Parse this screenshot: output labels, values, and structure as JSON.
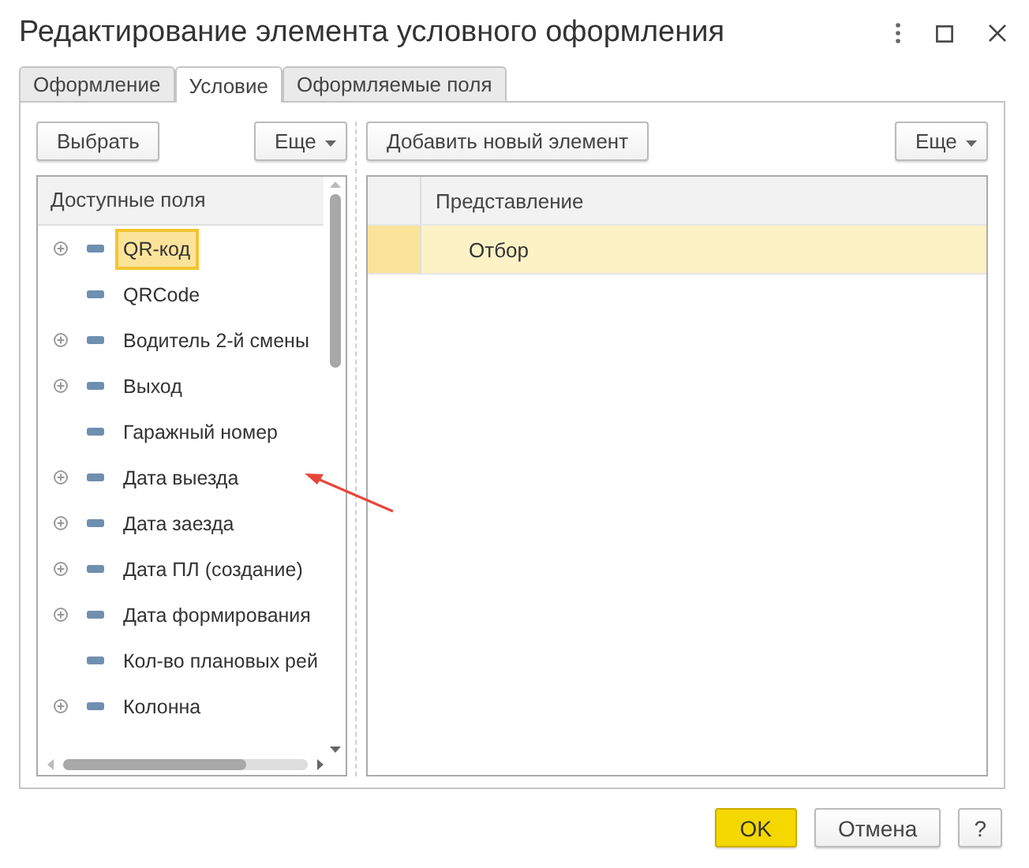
{
  "window": {
    "title": "Редактирование элемента условного оформления"
  },
  "tabs": [
    {
      "label": "Оформление",
      "selected": false
    },
    {
      "label": "Условие",
      "selected": true
    },
    {
      "label": "Оформляемые поля",
      "selected": false
    }
  ],
  "left": {
    "select_button": "Выбрать",
    "more_button": "Еще",
    "header": "Доступные поля",
    "items": [
      {
        "label": "QR-код",
        "expandable": true,
        "selected": true
      },
      {
        "label": "QRCode",
        "expandable": false,
        "selected": false
      },
      {
        "label": "Водитель 2-й смены",
        "expandable": true,
        "selected": false
      },
      {
        "label": "Выход",
        "expandable": true,
        "selected": false
      },
      {
        "label": "Гаражный номер",
        "expandable": false,
        "selected": false
      },
      {
        "label": "Дата выезда",
        "expandable": true,
        "selected": false
      },
      {
        "label": "Дата заезда",
        "expandable": true,
        "selected": false
      },
      {
        "label": "Дата ПЛ (создание)",
        "expandable": true,
        "selected": false
      },
      {
        "label": "Дата формирования",
        "expandable": true,
        "selected": false
      },
      {
        "label": "Кол-во плановых рей",
        "expandable": false,
        "selected": false
      },
      {
        "label": "Колонна",
        "expandable": true,
        "selected": false
      }
    ]
  },
  "right": {
    "add_button": "Добавить новый элемент",
    "more_button": "Еще",
    "header": "Представление",
    "rows": [
      {
        "label": "Отбор",
        "selected": true
      }
    ]
  },
  "buttons": {
    "ok": "OK",
    "cancel": "Отмена",
    "help": "?"
  }
}
